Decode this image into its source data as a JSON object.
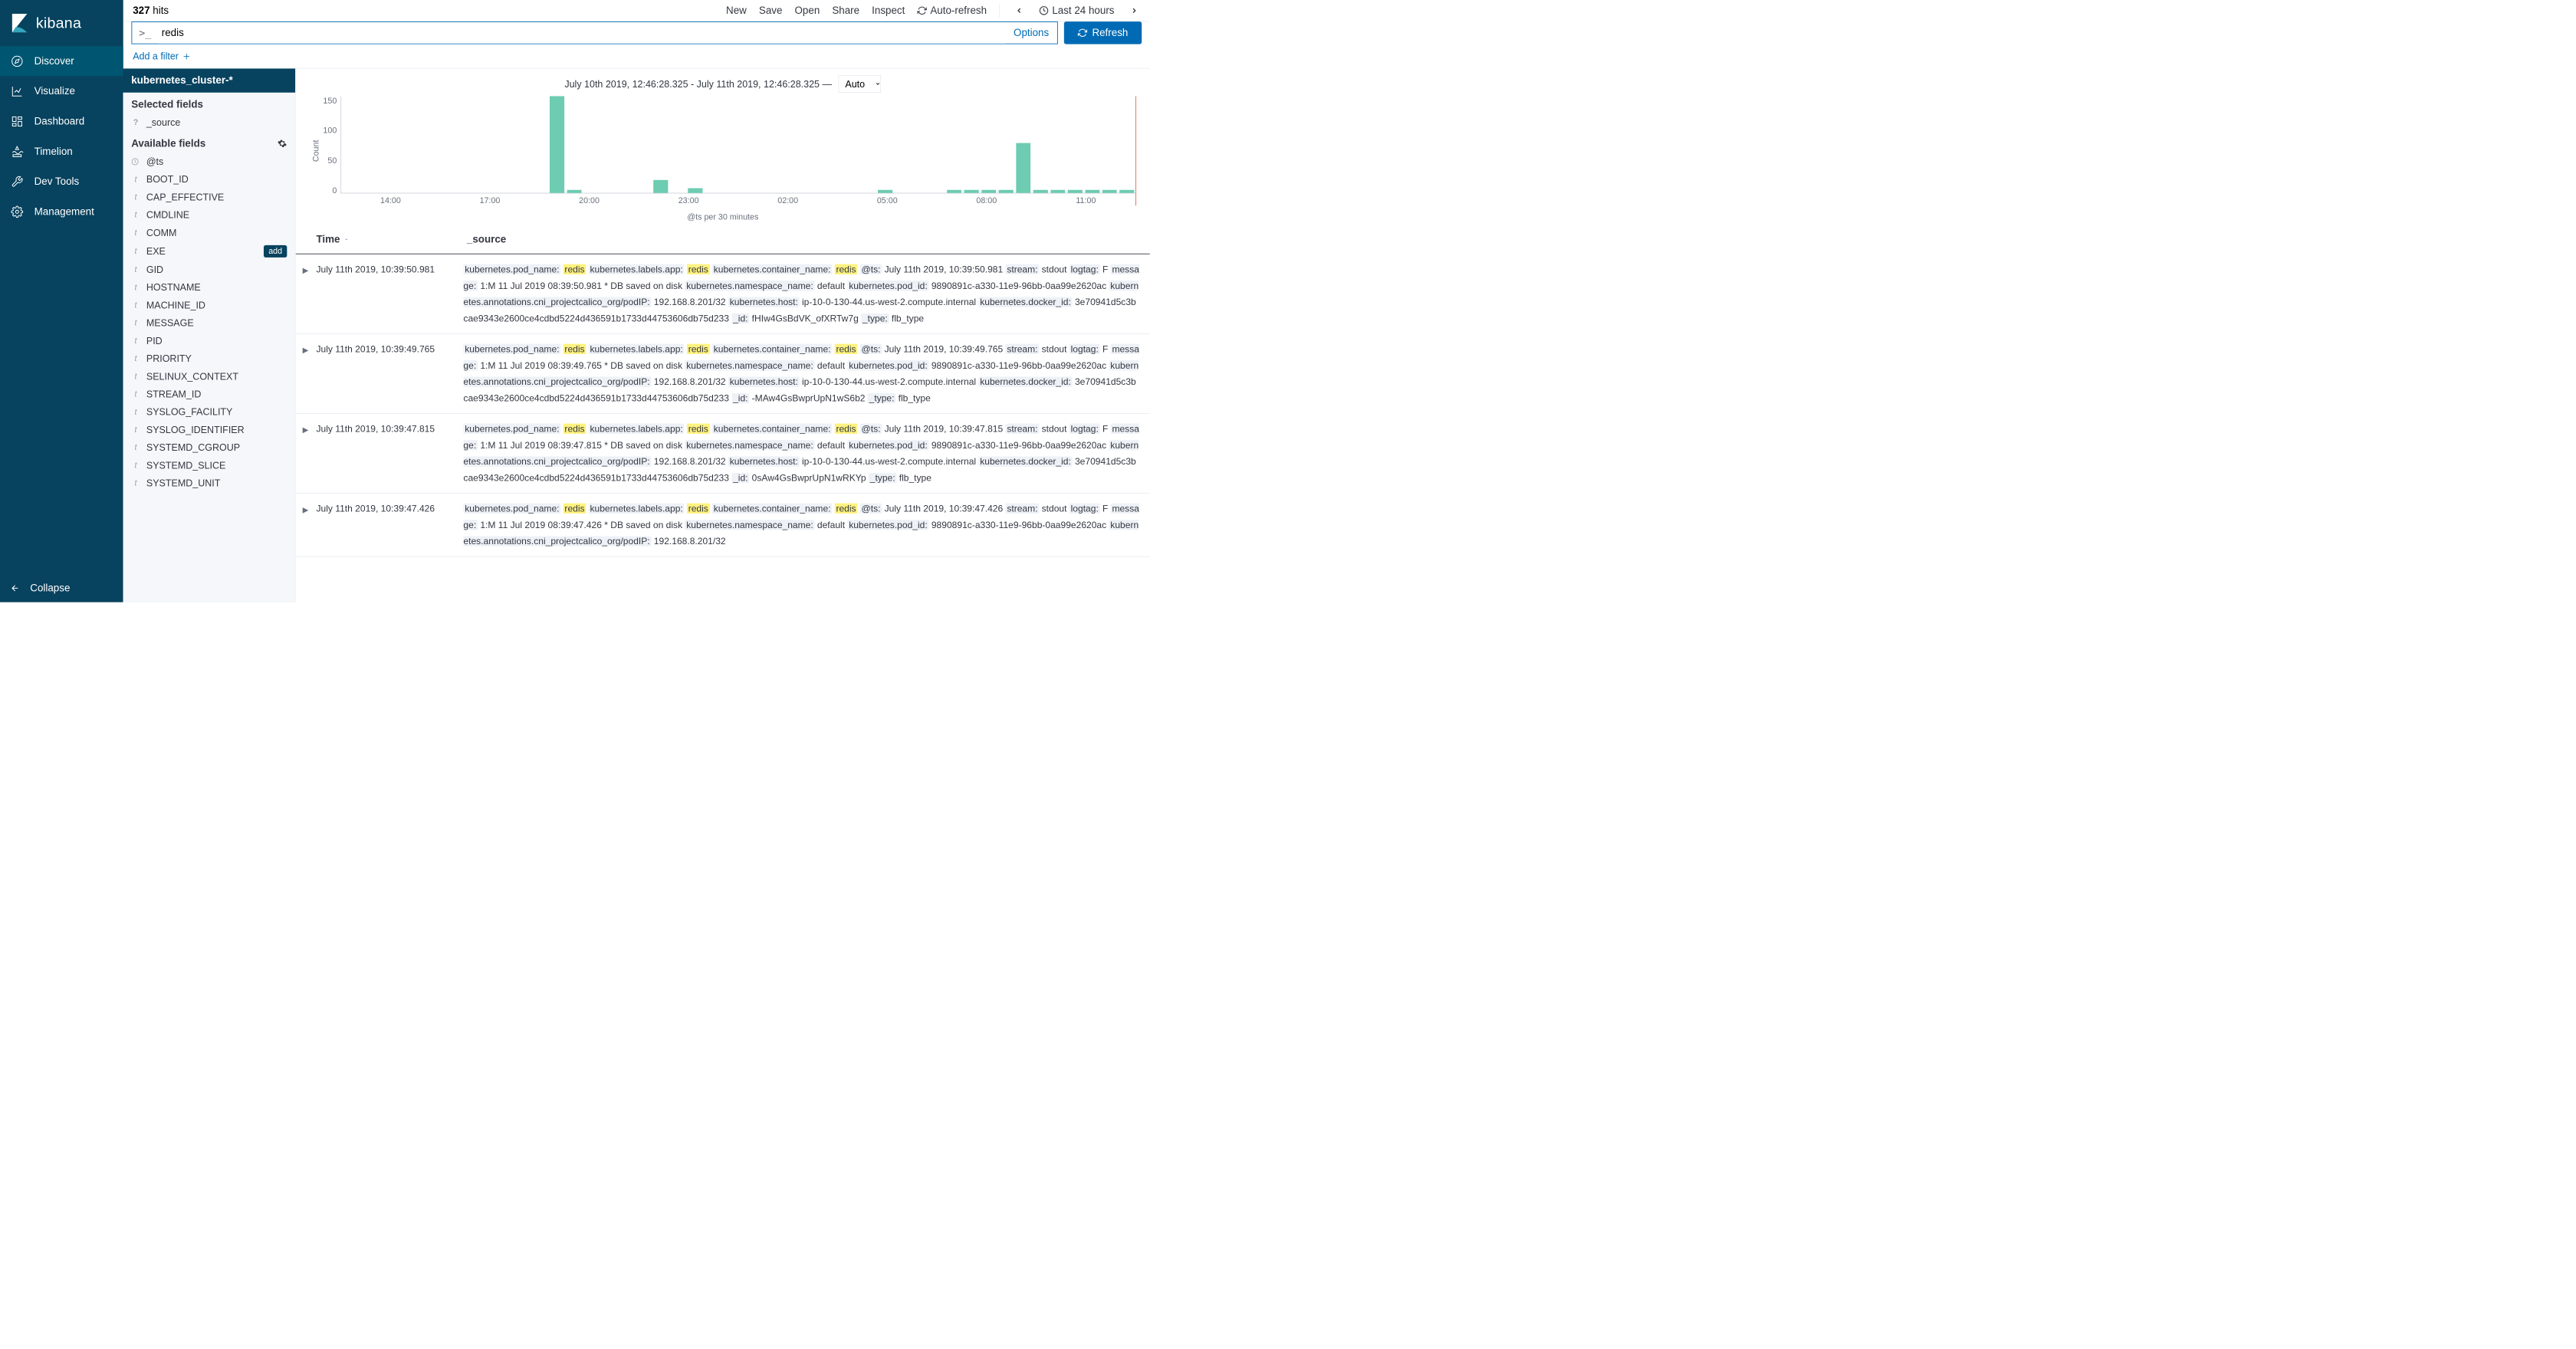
{
  "brand": "kibana",
  "nav": {
    "items": [
      {
        "label": "Discover",
        "active": true
      },
      {
        "label": "Visualize",
        "active": false
      },
      {
        "label": "Dashboard",
        "active": false
      },
      {
        "label": "Timelion",
        "active": false
      },
      {
        "label": "Dev Tools",
        "active": false
      },
      {
        "label": "Management",
        "active": false
      }
    ],
    "collapse": "Collapse"
  },
  "hits": {
    "count": "327",
    "label": "hits"
  },
  "top_actions": {
    "new": "New",
    "save": "Save",
    "open": "Open",
    "share": "Share",
    "inspect": "Inspect",
    "auto_refresh": "Auto-refresh",
    "time_range": "Last 24 hours"
  },
  "search": {
    "prefix": ">_",
    "value": "redis",
    "options": "Options",
    "refresh": "Refresh"
  },
  "filter_bar": {
    "label": "Add a filter"
  },
  "fields_panel": {
    "index_pattern": "kubernetes_cluster-*",
    "selected_label": "Selected fields",
    "available_label": "Available fields",
    "selected": [
      {
        "type": "?",
        "name": "_source"
      }
    ],
    "available": [
      {
        "type": "clock",
        "name": "@ts"
      },
      {
        "type": "t",
        "name": "BOOT_ID"
      },
      {
        "type": "t",
        "name": "CAP_EFFECTIVE"
      },
      {
        "type": "t",
        "name": "CMDLINE"
      },
      {
        "type": "t",
        "name": "COMM"
      },
      {
        "type": "t",
        "name": "EXE",
        "add": true
      },
      {
        "type": "t",
        "name": "GID"
      },
      {
        "type": "t",
        "name": "HOSTNAME"
      },
      {
        "type": "t",
        "name": "MACHINE_ID"
      },
      {
        "type": "t",
        "name": "MESSAGE"
      },
      {
        "type": "t",
        "name": "PID"
      },
      {
        "type": "t",
        "name": "PRIORITY"
      },
      {
        "type": "t",
        "name": "SELINUX_CONTEXT"
      },
      {
        "type": "t",
        "name": "STREAM_ID"
      },
      {
        "type": "t",
        "name": "SYSLOG_FACILITY"
      },
      {
        "type": "t",
        "name": "SYSLOG_IDENTIFIER"
      },
      {
        "type": "t",
        "name": "SYSTEMD_CGROUP"
      },
      {
        "type": "t",
        "name": "SYSTEMD_SLICE"
      },
      {
        "type": "t",
        "name": "SYSTEMD_UNIT"
      }
    ],
    "add_label": "add"
  },
  "chart_data": {
    "type": "bar",
    "title": "July 10th 2019, 12:46:28.325 - July 11th 2019, 12:46:28.325 —",
    "interval": "Auto",
    "ylabel": "Count",
    "xlabel": "@ts per 30 minutes",
    "ylim": [
      0,
      165
    ],
    "yticks": [
      "150",
      "100",
      "50",
      "0"
    ],
    "xticks": [
      "14:00",
      "17:00",
      "20:00",
      "23:00",
      "02:00",
      "05:00",
      "08:00",
      "11:00"
    ],
    "values": [
      0,
      0,
      0,
      0,
      0,
      0,
      0,
      0,
      0,
      0,
      0,
      0,
      165,
      5,
      0,
      0,
      0,
      0,
      22,
      0,
      8,
      0,
      0,
      0,
      0,
      0,
      0,
      0,
      0,
      0,
      0,
      5,
      0,
      0,
      0,
      5,
      5,
      5,
      5,
      85,
      5,
      5,
      5,
      5,
      5,
      5
    ]
  },
  "table": {
    "headers": {
      "time": "Time",
      "source": "_source"
    },
    "rows": [
      {
        "time": "July 11th 2019, 10:39:50.981",
        "fields": {
          "kubernetes.pod_name": "redis",
          "kubernetes.labels.app": "redis",
          "kubernetes.container_name": "redis",
          "@ts": "July 11th 2019, 10:39:50.981",
          "stream": "stdout",
          "logtag": "F",
          "message": "1:M 11 Jul 2019 08:39:50.981 * DB saved on disk",
          "kubernetes.namespace_name": "default",
          "kubernetes.pod_id": "9890891c-a330-11e9-96bb-0aa99e2620ac",
          "kubernetes.annotations.cni_projectcalico_org/podIP": "192.168.8.201/32",
          "kubernetes.host": "ip-10-0-130-44.us-west-2.compute.internal",
          "kubernetes.docker_id": "3e70941d5c3bcae9343e2600ce4cdbd5224d436591b1733d44753606db75d233",
          "_id": "fHIw4GsBdVK_ofXRTw7g",
          "_type": "flb_type"
        }
      },
      {
        "time": "July 11th 2019, 10:39:49.765",
        "fields": {
          "kubernetes.pod_name": "redis",
          "kubernetes.labels.app": "redis",
          "kubernetes.container_name": "redis",
          "@ts": "July 11th 2019, 10:39:49.765",
          "stream": "stdout",
          "logtag": "F",
          "message": "1:M 11 Jul 2019 08:39:49.765 * DB saved on disk",
          "kubernetes.namespace_name": "default",
          "kubernetes.pod_id": "9890891c-a330-11e9-96bb-0aa99e2620ac",
          "kubernetes.annotations.cni_projectcalico_org/podIP": "192.168.8.201/32",
          "kubernetes.host": "ip-10-0-130-44.us-west-2.compute.internal",
          "kubernetes.docker_id": "3e70941d5c3bcae9343e2600ce4cdbd5224d436591b1733d44753606db75d233",
          "_id": "-MAw4GsBwprUpN1wS6b2",
          "_type": "flb_type"
        }
      },
      {
        "time": "July 11th 2019, 10:39:47.815",
        "fields": {
          "kubernetes.pod_name": "redis",
          "kubernetes.labels.app": "redis",
          "kubernetes.container_name": "redis",
          "@ts": "July 11th 2019, 10:39:47.815",
          "stream": "stdout",
          "logtag": "F",
          "message": "1:M 11 Jul 2019 08:39:47.815 * DB saved on disk",
          "kubernetes.namespace_name": "default",
          "kubernetes.pod_id": "9890891c-a330-11e9-96bb-0aa99e2620ac",
          "kubernetes.annotations.cni_projectcalico_org/podIP": "192.168.8.201/32",
          "kubernetes.host": "ip-10-0-130-44.us-west-2.compute.internal",
          "kubernetes.docker_id": "3e70941d5c3bcae9343e2600ce4cdbd5224d436591b1733d44753606db75d233",
          "_id": "0sAw4GsBwprUpN1wRKYp",
          "_type": "flb_type"
        }
      },
      {
        "time": "July 11th 2019, 10:39:47.426",
        "fields": {
          "kubernetes.pod_name": "redis",
          "kubernetes.labels.app": "redis",
          "kubernetes.container_name": "redis",
          "@ts": "July 11th 2019, 10:39:47.426",
          "stream": "stdout",
          "logtag": "F",
          "message": "1:M 11 Jul 2019 08:39:47.426 * DB saved on disk",
          "kubernetes.namespace_name": "default",
          "kubernetes.pod_id": "9890891c-a330-11e9-96bb-0aa99e2620ac",
          "kubernetes.annotations.cni_projectcalico_org/podIP": "192.168.8.201/32"
        }
      }
    ]
  },
  "highlight": "redis"
}
